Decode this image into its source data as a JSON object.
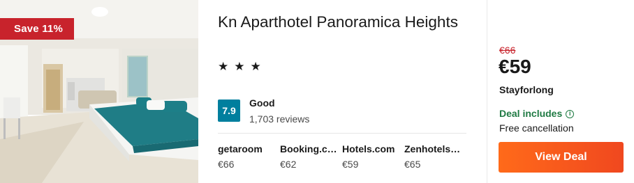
{
  "hotel": {
    "name": "Kn Aparthotel Panoramica Heights",
    "stars": 3,
    "save_badge": "Save 11%",
    "rating": {
      "score": "7.9",
      "label": "Good",
      "reviews": "1,703 reviews"
    },
    "providers": [
      {
        "name": "getaroom",
        "price": "€66"
      },
      {
        "name": "Booking.com",
        "price": "€62"
      },
      {
        "name": "Hotels.com",
        "price": "€59"
      },
      {
        "name": "Zenhotels.com",
        "price": "€65"
      }
    ]
  },
  "deal": {
    "old_price": "€66",
    "price": "€59",
    "provider": "Stayforlong",
    "includes_label": "Deal includes",
    "includes_item": "Free cancellation",
    "button_label": "View Deal"
  },
  "icons": {
    "star": "star-icon",
    "info": "info-icon"
  },
  "colors": {
    "save_badge": "#c8232c",
    "score_box": "#007f9e",
    "deal_green": "#1f7a43",
    "old_price_red": "#c8232c",
    "button": "#f45a1d"
  }
}
